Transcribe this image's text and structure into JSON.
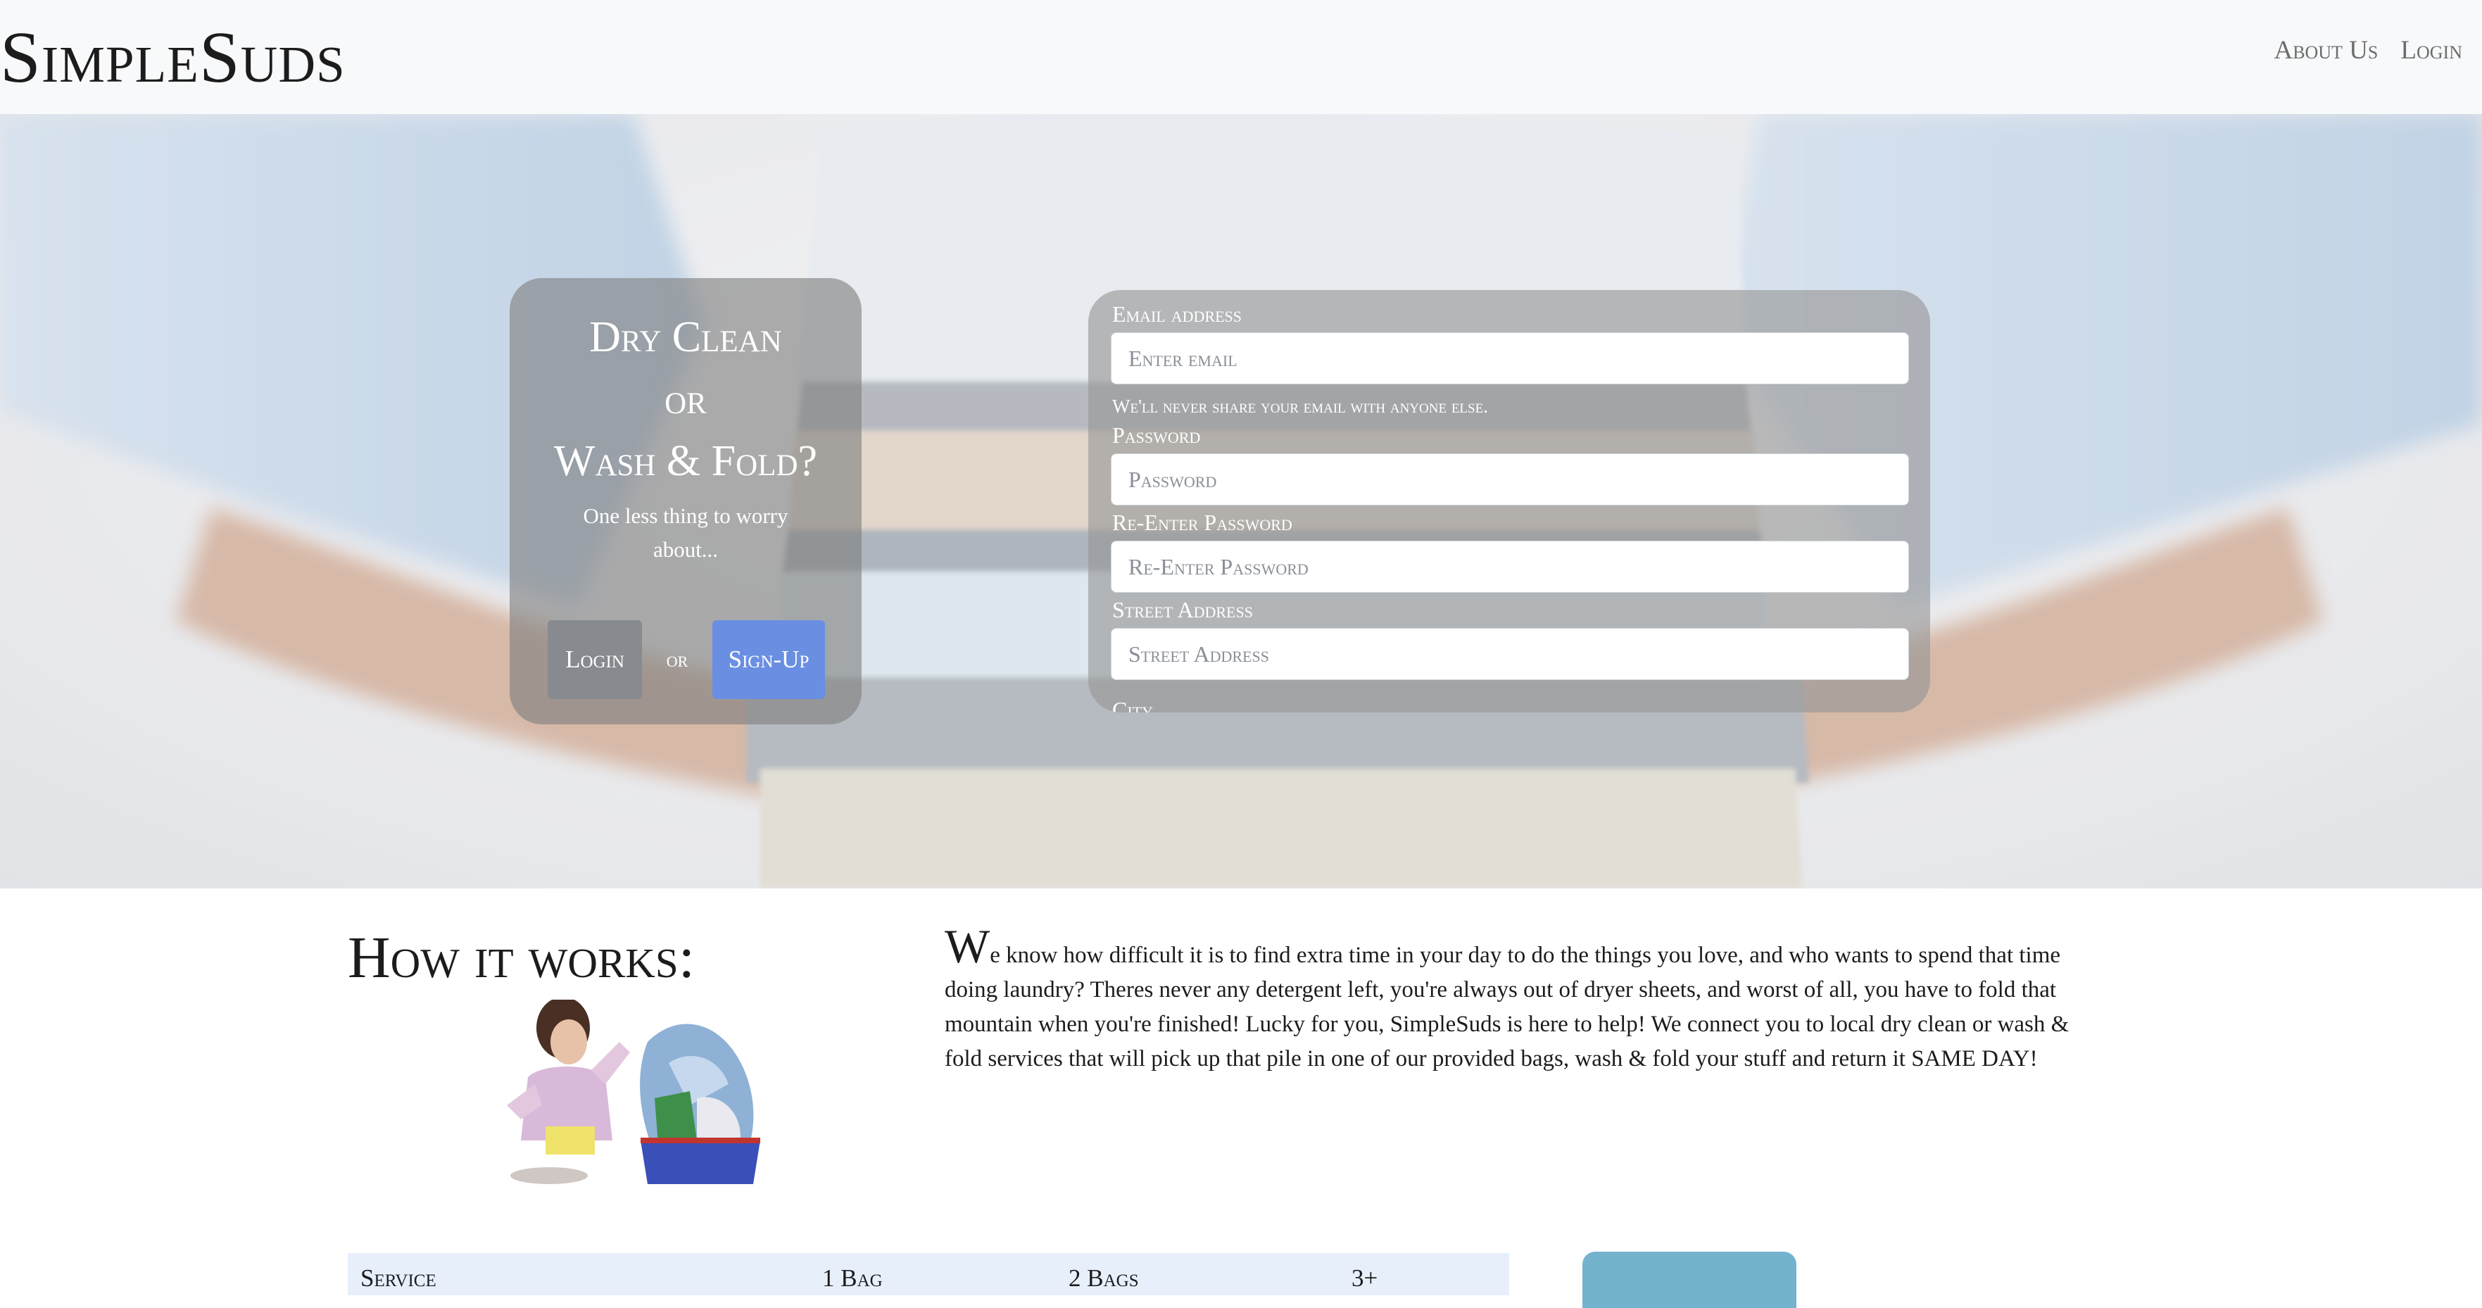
{
  "navbar": {
    "brand": "SimpleSuds",
    "links": [
      "About Us",
      "Login"
    ]
  },
  "hero": {
    "cta": {
      "line1": "Dry Clean",
      "line2": "or",
      "line3": "Wash & Fold?",
      "subtitle": "One less thing to worry about...",
      "login_label": "Login",
      "or_label": "or",
      "signup_label": "Sign-Up"
    },
    "form": {
      "email_label": "Email address",
      "email_placeholder": "Enter email",
      "email_help": "We'll never share your email with anyone else.",
      "password_label": "Password",
      "password_placeholder": "Password",
      "reenter_label": "Re-Enter Password",
      "reenter_placeholder": "Re-Enter Password",
      "street_label": "Street Address",
      "street_placeholder": "Street Address",
      "city_label": "City"
    }
  },
  "how": {
    "heading": "How it works:",
    "drop_cap": "W",
    "body_main": "e know how difficult it is to find extra time in your day to do the things you love, and who wants to spend that time doing laundry? Theres never any detergent left, you're always out of dryer sheets, and worst of all, you have to fold that mountain when you're finished! Lucky for you, SimpleSuds is here to help! We connect you to local dry clean or wash & fold services that will pick up that pile in one of our provided bags, wash & fold your stuff and return it ",
    "body_emph": "SAME DAY!"
  },
  "pricing": {
    "headers": [
      "Service",
      "1 Bag",
      "2 Bags",
      "3+"
    ]
  },
  "colors": {
    "navbar_bg": "#f8f9fa",
    "signup_btn": "#6a8fe2",
    "login_btn": "#878a8e",
    "table_header_bg": "#e7effb",
    "side_button": "#73b3cd"
  }
}
